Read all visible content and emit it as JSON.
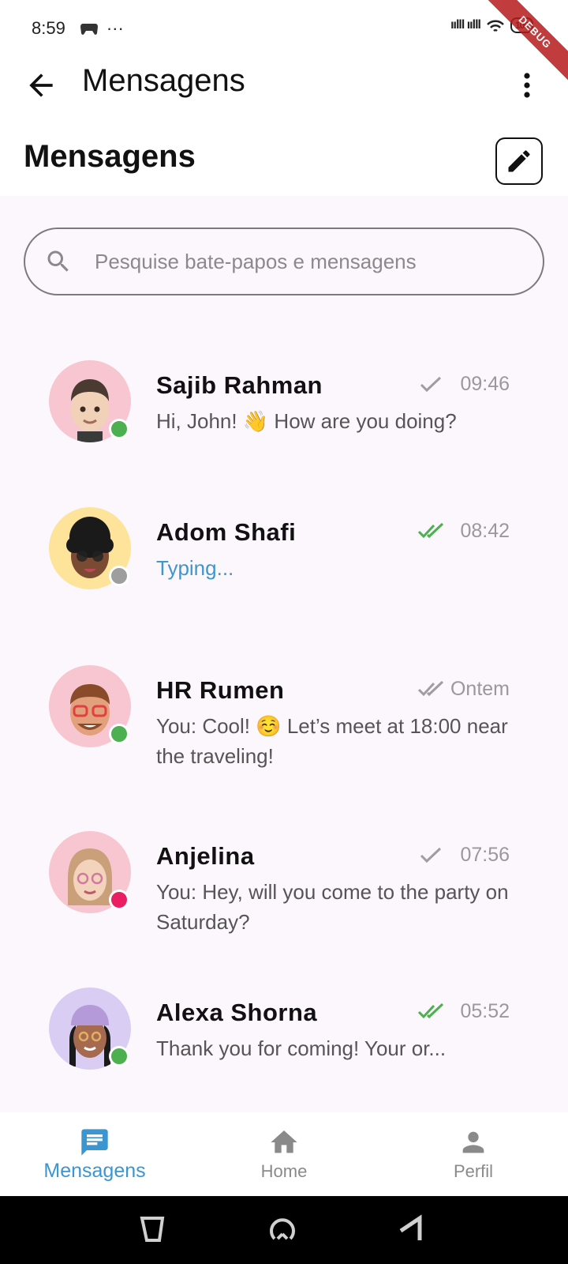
{
  "status_bar": {
    "time": "8:59",
    "dots": "···",
    "signal": "ıılll ıılll",
    "battery": "100"
  },
  "debug_banner": "DEBUG",
  "app_bar": {
    "title": "Mensagens"
  },
  "section_title": "Mensagens",
  "search": {
    "placeholder": "Pesquise bate-papos e mensagens"
  },
  "chats": [
    {
      "name": "Sajib Rahman",
      "time": "09:46",
      "message": "Hi, John! 👋 How are you doing?",
      "tick": "single",
      "online": "online"
    },
    {
      "name": "Adom Shafi",
      "time": "08:42",
      "message": "Typing...",
      "tick": "double-read",
      "online": "offline"
    },
    {
      "name": "HR Rumen",
      "time": "Ontem",
      "message": "You: Cool! ☺️ Let’s meet at 18:00 near the traveling!",
      "tick": "double",
      "online": "online"
    },
    {
      "name": "Anjelina",
      "time": "07:56",
      "message": "You: Hey, will you come to the party on Saturday?",
      "tick": "single",
      "online": "busy"
    },
    {
      "name": "Alexa Shorna",
      "time": "05:52",
      "message": "Thank you for coming! Your or...",
      "tick": "double-read",
      "online": "online"
    }
  ],
  "bottom_nav": [
    {
      "label": "Mensagens",
      "icon": "chat-icon",
      "active": true
    },
    {
      "label": "Home",
      "icon": "home-icon",
      "active": false
    },
    {
      "label": "Perfil",
      "icon": "person-icon",
      "active": false
    }
  ],
  "colors": {
    "accent": "#3b95d1",
    "online": "#4caf50",
    "offline": "#9e9e9e",
    "busy": "#e91e63",
    "read_tick": "#4caf50",
    "unread_tick": "#9e9e9e",
    "content_bg": "#fcf7fc"
  }
}
